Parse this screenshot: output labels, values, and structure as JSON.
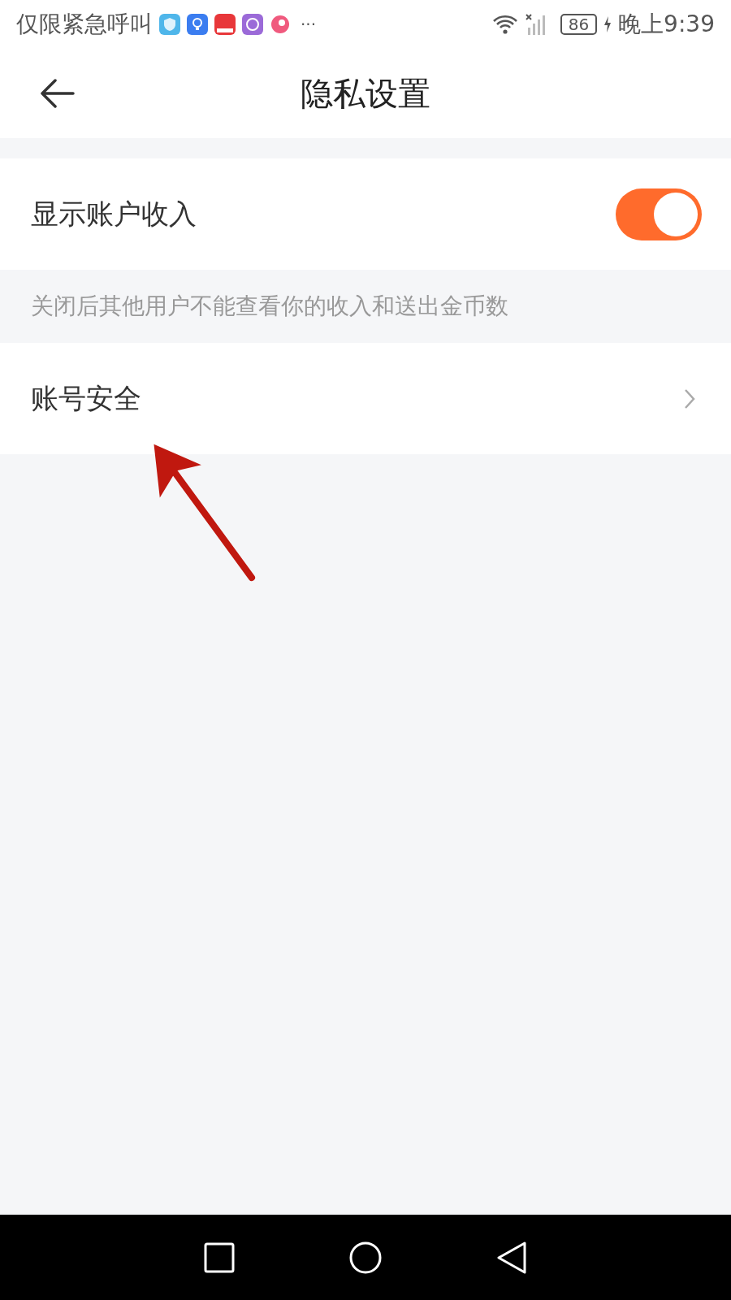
{
  "status_bar": {
    "carrier": "仅限紧急呼叫",
    "more": "···",
    "battery": "86",
    "time": "晚上9:39"
  },
  "header": {
    "title": "隐私设置"
  },
  "settings": [
    {
      "kind": "toggle",
      "label": "显示账户收入",
      "on": true
    },
    {
      "kind": "hint",
      "label": "关闭后其他用户不能查看你的收入和送出金币数"
    },
    {
      "kind": "link",
      "label": "账号安全"
    }
  ]
}
